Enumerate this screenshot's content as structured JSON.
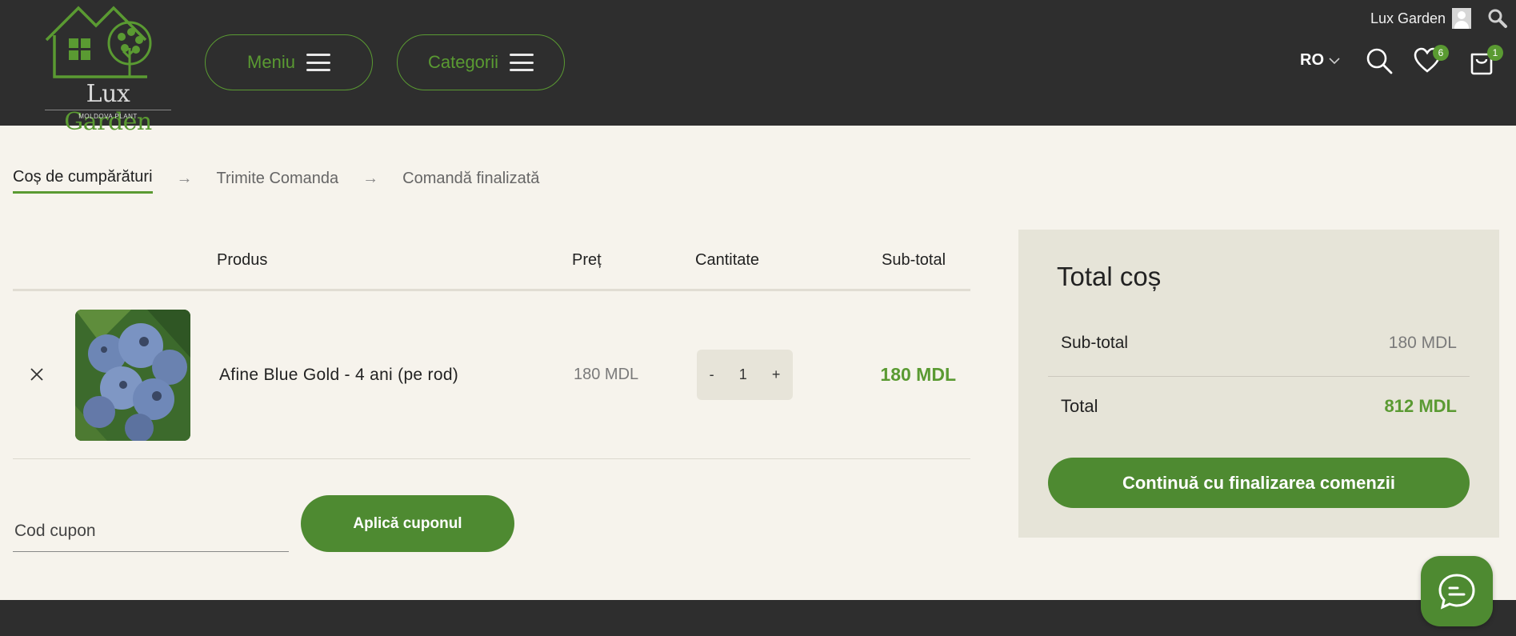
{
  "header": {
    "logo": {
      "brand_part1": "Lux",
      "brand_part2": "Garden",
      "tagline": "MOLDOVA PLANT"
    },
    "menu_label": "Meniu",
    "categories_label": "Categorii",
    "account_name": "Lux Garden",
    "language": "RO",
    "wishlist_count": "6",
    "cart_count": "1"
  },
  "steps": [
    {
      "label": "Coș de cumpărături",
      "active": true
    },
    {
      "label": "Trimite Comanda",
      "active": false
    },
    {
      "label": "Comandă finalizată",
      "active": false
    }
  ],
  "cart": {
    "columns": {
      "product": "Produs",
      "price": "Preț",
      "quantity": "Cantitate",
      "subtotal": "Sub-total"
    },
    "items": [
      {
        "name": "Afine Blue Gold - 4 ani (pe rod)",
        "price": "180 MDL",
        "quantity": "1",
        "subtotal": "180 MDL",
        "qty_minus": "-",
        "qty_plus": "+"
      }
    ]
  },
  "coupon": {
    "placeholder": "Cod cupon",
    "button_label": "Aplică cuponul"
  },
  "totals": {
    "title": "Total coș",
    "subtotal_label": "Sub-total",
    "subtotal_value": "180 MDL",
    "total_label": "Total",
    "total_value": "812 MDL",
    "checkout_label": "Continuă cu finalizarea comenzii"
  },
  "colors": {
    "accent": "#4e8a31",
    "header_bg": "#2e2e2e",
    "page_bg": "#f6f3ec",
    "totals_bg": "#e6e4d8"
  },
  "icons": [
    "house-tree-logo",
    "hamburger-icon",
    "user-icon",
    "search-icon",
    "chevron-down-icon",
    "heart-icon",
    "shopping-bag-icon",
    "close-icon",
    "arrow-right-icon",
    "chat-icon"
  ]
}
